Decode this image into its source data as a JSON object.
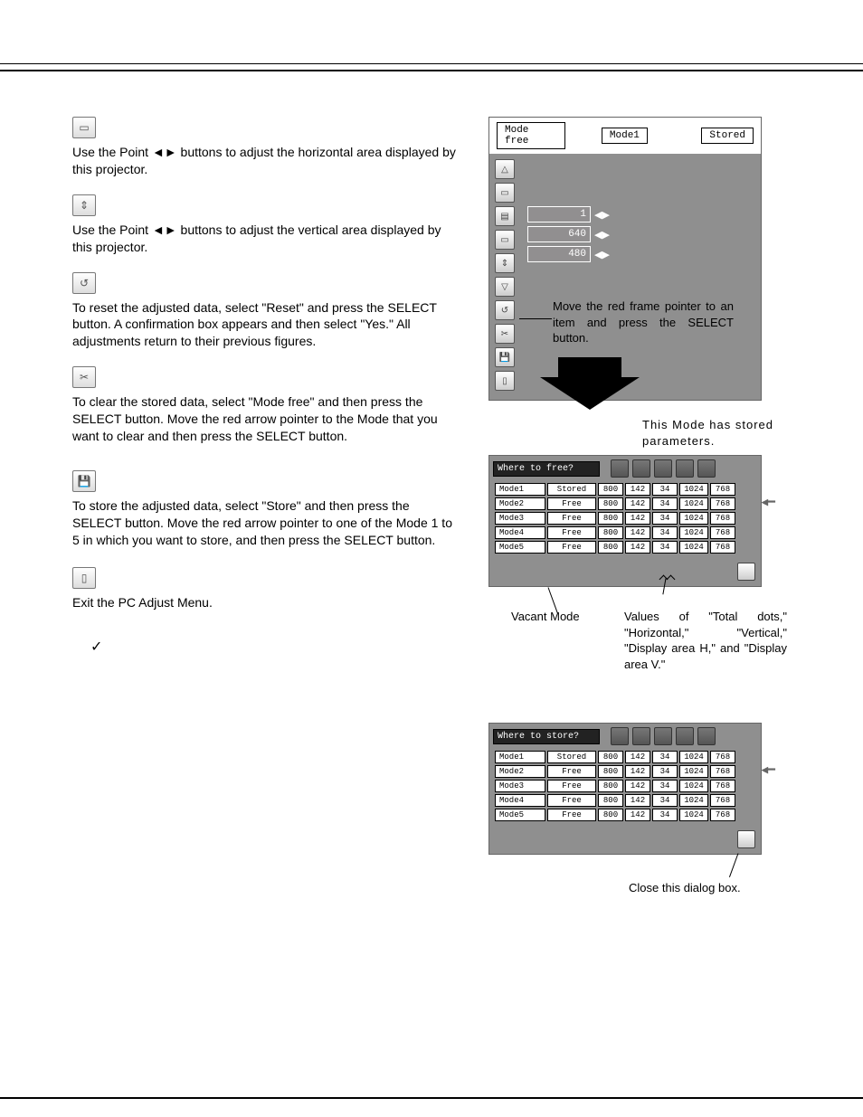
{
  "sections": {
    "display_area_h": "Use the Point ◄► buttons to adjust the horizontal area displayed by this projector.",
    "display_area_v": "Use the Point ◄► buttons to adjust the vertical area displayed by this projector.",
    "reset": "To reset the adjusted data, select \"Reset\" and press the SELECT button. A confirmation box appears and then select \"Yes.\" All adjustments return to their previous figures.",
    "mode_free": "To clear the stored data, select \"Mode free\" and then press the SELECT button. Move the red arrow pointer to the Mode that you want to clear and then press the SELECT button.",
    "store": "To store the adjusted data, select \"Store\" and then press the SELECT button. Move the red arrow pointer to one of the Mode 1 to 5 in which you want to store, and then press the SELECT button.",
    "quit": "Exit the PC Adjust Menu."
  },
  "panel1": {
    "tab_left": "Mode free",
    "tab_mid": "Mode1",
    "tab_right": "Stored",
    "values": [
      "1",
      "640",
      "480"
    ],
    "instruction": "Move the red frame pointer to an item and press the SELECT button."
  },
  "note_mode_stored": "This Mode has stored parameters.",
  "table_free": {
    "title": "Where to free?",
    "rows": [
      {
        "name": "Mode1",
        "status": "Stored",
        "v": [
          "800",
          "142",
          "34",
          "1024",
          "768"
        ]
      },
      {
        "name": "Mode2",
        "status": "Free",
        "v": [
          "800",
          "142",
          "34",
          "1024",
          "768"
        ]
      },
      {
        "name": "Mode3",
        "status": "Free",
        "v": [
          "800",
          "142",
          "34",
          "1024",
          "768"
        ]
      },
      {
        "name": "Mode4",
        "status": "Free",
        "v": [
          "800",
          "142",
          "34",
          "1024",
          "768"
        ]
      },
      {
        "name": "Mode5",
        "status": "Free",
        "v": [
          "800",
          "142",
          "34",
          "1024",
          "768"
        ]
      }
    ]
  },
  "annot_vacant": "Vacant Mode",
  "annot_values": "Values of \"Total dots,\" \"Horizontal,\" \"Vertical,\" \"Display area H,\" and \"Display area V.\"",
  "table_store": {
    "title": "Where to store?",
    "rows": [
      {
        "name": "Mode1",
        "status": "Stored",
        "v": [
          "800",
          "142",
          "34",
          "1024",
          "768"
        ]
      },
      {
        "name": "Mode2",
        "status": "Free",
        "v": [
          "800",
          "142",
          "34",
          "1024",
          "768"
        ]
      },
      {
        "name": "Mode3",
        "status": "Free",
        "v": [
          "800",
          "142",
          "34",
          "1024",
          "768"
        ]
      },
      {
        "name": "Mode4",
        "status": "Free",
        "v": [
          "800",
          "142",
          "34",
          "1024",
          "768"
        ]
      },
      {
        "name": "Mode5",
        "status": "Free",
        "v": [
          "800",
          "142",
          "34",
          "1024",
          "768"
        ]
      }
    ]
  },
  "annot_close": "Close this dialog box.",
  "check": "✓"
}
